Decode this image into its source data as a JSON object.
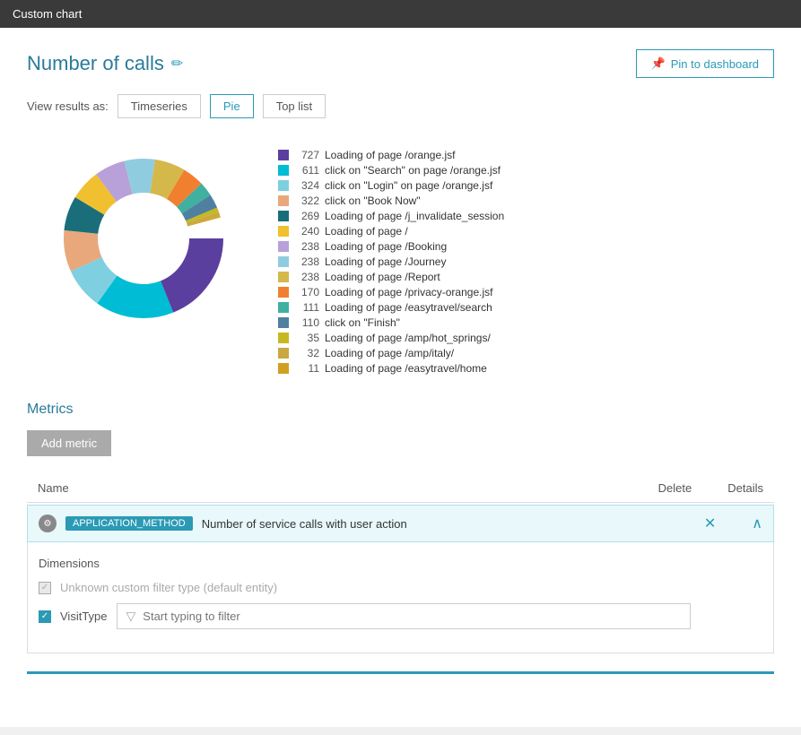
{
  "titleBar": {
    "label": "Custom chart"
  },
  "header": {
    "title": "Number of calls",
    "editIconLabel": "✏",
    "pinButton": "Pin to dashboard",
    "pinIconLabel": "📌"
  },
  "viewResults": {
    "label": "View results as:",
    "buttons": [
      {
        "id": "timeseries",
        "label": "Timeseries",
        "active": false
      },
      {
        "id": "pie",
        "label": "Pie",
        "active": true
      },
      {
        "id": "toplist",
        "label": "Top list",
        "active": false
      }
    ]
  },
  "chart": {
    "segments": [
      {
        "label": "Loading of page /orange.jsf",
        "count": "727",
        "color": "#5b3f9e",
        "percent": 19
      },
      {
        "label": "click on \"Search\" on page /orange.jsf",
        "count": "611",
        "color": "#00bcd4",
        "percent": 16
      },
      {
        "label": "click on \"Login\" on page /orange.jsf",
        "count": "324",
        "color": "#7ecfe0",
        "percent": 8.5
      },
      {
        "label": "click on \"Book Now\"",
        "count": "322",
        "color": "#e8a87c",
        "percent": 8.4
      },
      {
        "label": "Loading of page /j_invalidate_session",
        "count": "269",
        "color": "#1a6e7a",
        "percent": 7
      },
      {
        "label": "Loading of page /",
        "count": "240",
        "color": "#f0c030",
        "percent": 6.3
      },
      {
        "label": "Loading of page /Booking",
        "count": "238",
        "color": "#b8a0d8",
        "percent": 6.2
      },
      {
        "label": "Loading of page /Journey",
        "count": "238",
        "color": "#90cce0",
        "percent": 6.2
      },
      {
        "label": "Loading of page /Report",
        "count": "238",
        "color": "#d4b84a",
        "percent": 6.2
      },
      {
        "label": "Loading of page /privacy-orange.jsf",
        "count": "170",
        "color": "#f08030",
        "percent": 4.4
      },
      {
        "label": "Loading of page /easytravel/search",
        "count": "111",
        "color": "#40b0a0",
        "percent": 2.9
      },
      {
        "label": "click on \"Finish\"",
        "count": "110",
        "color": "#5080a0",
        "percent": 2.9
      },
      {
        "label": "Loading of page /amp/hot_springs/",
        "count": "35",
        "color": "#c8b820",
        "percent": 0.9
      },
      {
        "label": "Loading of page /amp/italy/",
        "count": "32",
        "color": "#c8a840",
        "percent": 0.8
      },
      {
        "label": "Loading of page /easytravel/home",
        "count": "11",
        "color": "#d0a020",
        "percent": 0.3
      }
    ]
  },
  "metrics": {
    "sectionTitle": "Metrics",
    "addButtonLabel": "Add metric",
    "tableHeaders": {
      "name": "Name",
      "delete": "Delete",
      "details": "Details"
    },
    "rows": [
      {
        "icon": "⚙",
        "tag": "APPLICATION_METHOD",
        "description": "Number of service calls with user action"
      }
    ]
  },
  "dimensions": {
    "title": "Dimensions",
    "items": [
      {
        "id": "unknown",
        "label": "Unknown custom filter type (default entity)",
        "checked": false,
        "disabled": true
      },
      {
        "id": "visittype",
        "label": "VisitType",
        "checked": true,
        "disabled": false
      }
    ],
    "filterPlaceholder": "Start typing to filter"
  }
}
